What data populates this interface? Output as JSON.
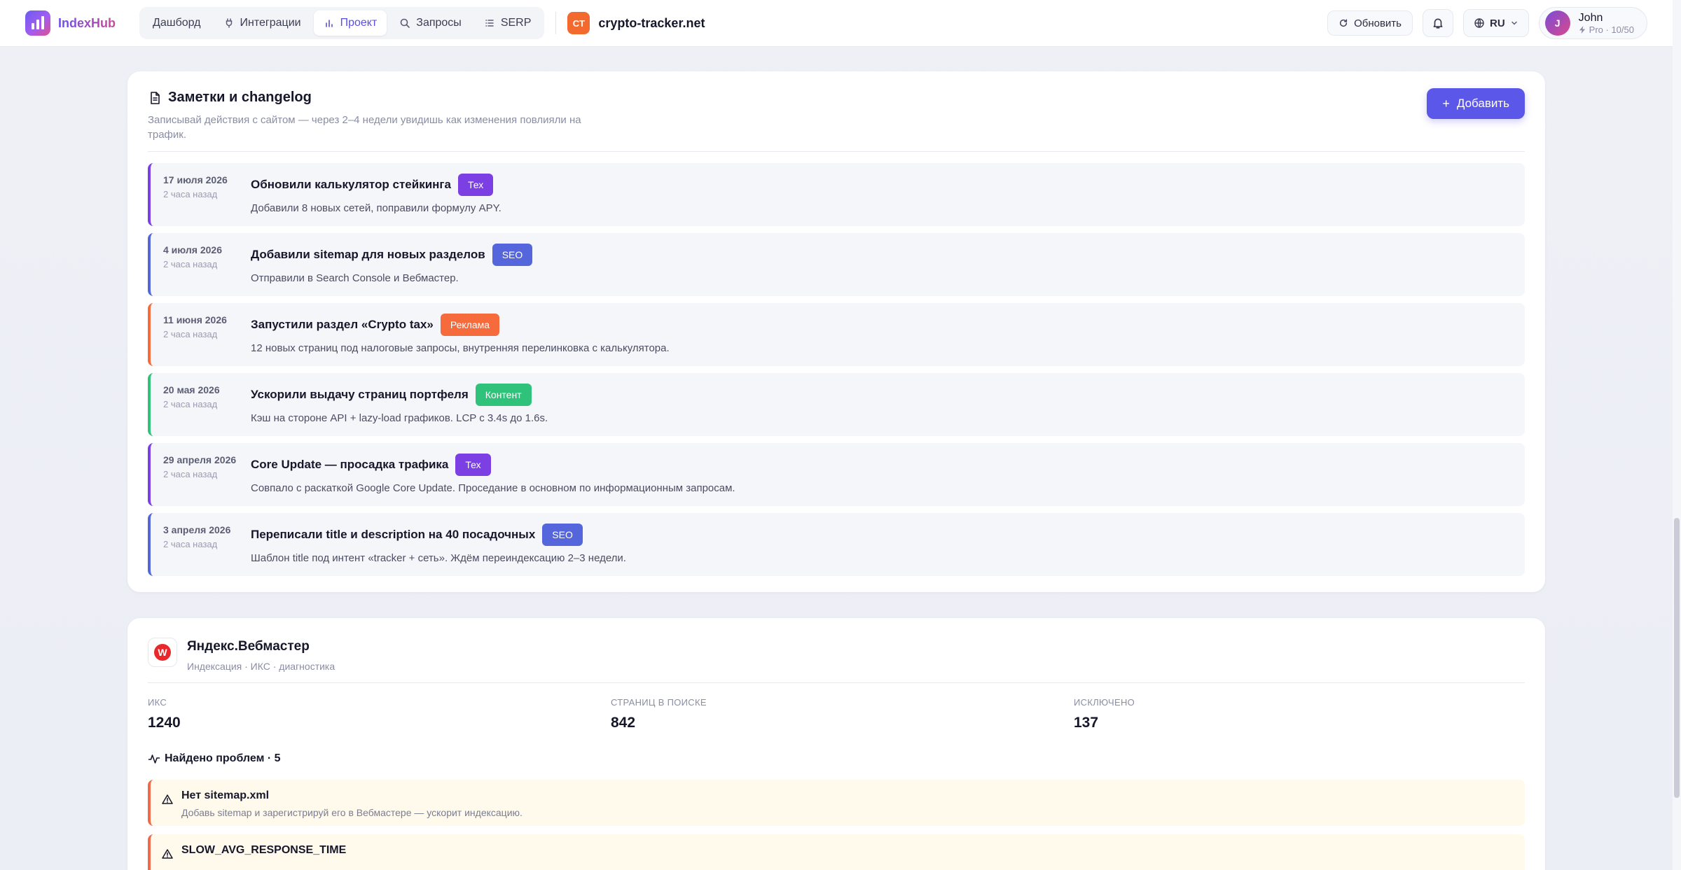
{
  "app": {
    "brand": "IndexHub"
  },
  "nav": {
    "items": [
      {
        "label": "Дашборд",
        "icon": "none"
      },
      {
        "label": "Интеграции",
        "icon": "plug-icon"
      },
      {
        "label": "Проект",
        "icon": "bar-chart-icon",
        "active": true
      },
      {
        "label": "Запросы",
        "icon": "search-icon"
      },
      {
        "label": "SERP",
        "icon": "list-icon"
      }
    ]
  },
  "site": {
    "badge": "CT",
    "name": "crypto-tracker.net",
    "badge_color": "#f26a2e"
  },
  "topbar": {
    "refresh_label": "Обновить",
    "language": "RU",
    "user": {
      "initial": "J",
      "name": "John",
      "plan": "Pro · 10/50"
    }
  },
  "notes": {
    "title": "Заметки и changelog",
    "subtitle": "Записывай действия с сайтом — через 2–4 недели увидишь как изменения повлияли на трафик.",
    "add_label": "Добавить",
    "items": [
      {
        "date": "17 июля 2026",
        "ago": "2 часа назад",
        "title": "Обновили калькулятор стейкинга",
        "tag": "Тех",
        "tag_kind": "tech",
        "desc": "Добавили 8 новых сетей, поправили формулу APY."
      },
      {
        "date": "4 июля 2026",
        "ago": "2 часа назад",
        "title": "Добавили sitemap для новых разделов",
        "tag": "SEO",
        "tag_kind": "seo",
        "desc": "Отправили в Search Console и Вебмастер."
      },
      {
        "date": "11 июня 2026",
        "ago": "2 часа назад",
        "title": "Запустили раздел «Crypto tax»",
        "tag": "Реклама",
        "tag_kind": "ad",
        "desc": "12 новых страниц под налоговые запросы, внутренняя перелинковка с калькулятора."
      },
      {
        "date": "20 мая 2026",
        "ago": "2 часа назад",
        "title": "Ускорили выдачу страниц портфеля",
        "tag": "Контент",
        "tag_kind": "content",
        "desc": "Кэш на стороне API + lazy-load графиков. LCP с 3.4s до 1.6s."
      },
      {
        "date": "29 апреля 2026",
        "ago": "2 часа назад",
        "title": "Core Update — просадка трафика",
        "tag": "Тех",
        "tag_kind": "tech",
        "desc": "Совпало с раскаткой Google Core Update. Проседание в основном по информационным запросам."
      },
      {
        "date": "3 апреля 2026",
        "ago": "2 часа назад",
        "title": "Переписали title и description на 40 посадочных",
        "tag": "SEO",
        "tag_kind": "seo",
        "desc": "Шаблон title под интент «tracker + сеть». Ждём переиндексацию 2–3 недели."
      }
    ]
  },
  "webmaster": {
    "logo_letter": "W",
    "title": "Яндекс.Вебмастер",
    "subtitle": "Индексация · ИКС · диагностика",
    "metrics": [
      {
        "label": "ИКС",
        "value": "1240"
      },
      {
        "label": "СТРАНИЦ В ПОИСКЕ",
        "value": "842"
      },
      {
        "label": "ИСКЛЮЧЕНО",
        "value": "137"
      }
    ],
    "problems_title": "Найдено проблем · 5",
    "problems": [
      {
        "title": "Нет sitemap.xml",
        "desc": "Добавь sitemap и зарегистрируй его в Вебмастере — ускорит индексацию."
      },
      {
        "title": "SLOW_AVG_RESPONSE_TIME",
        "desc": ""
      }
    ]
  }
}
